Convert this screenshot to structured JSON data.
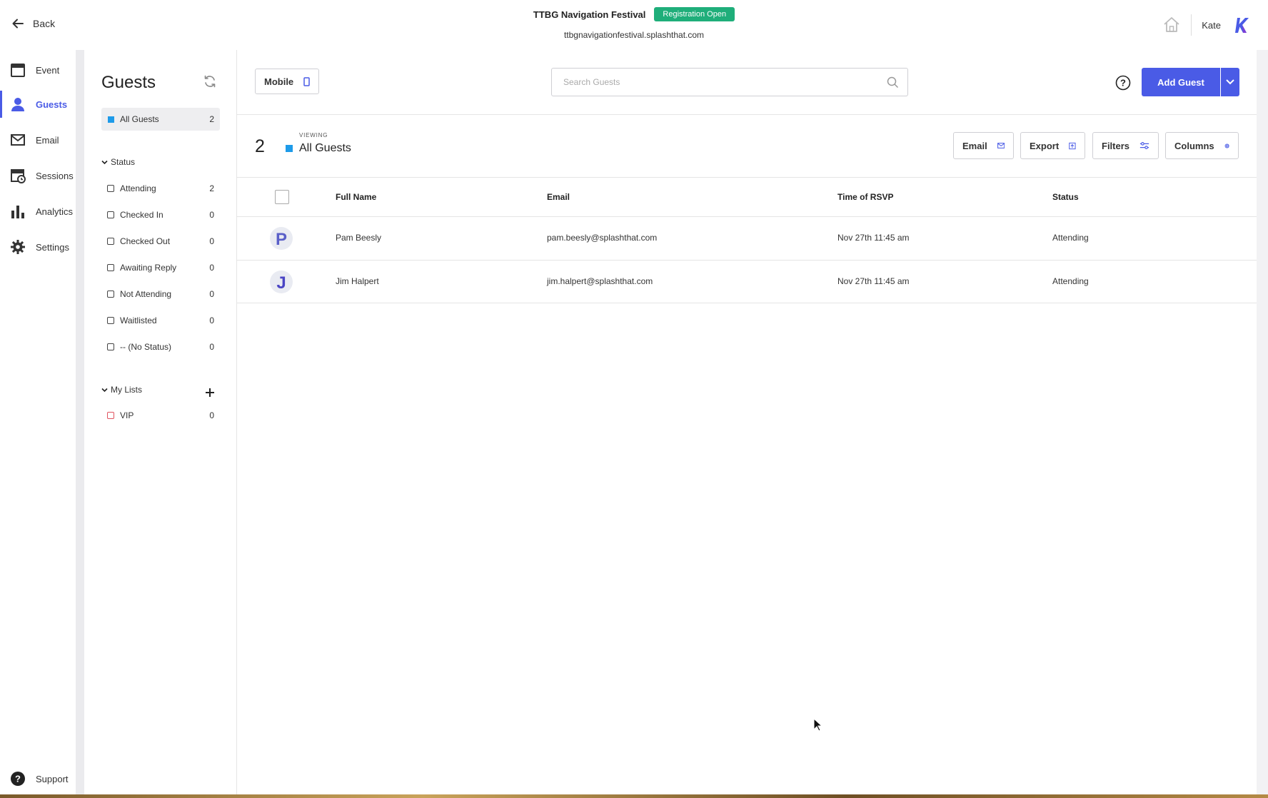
{
  "topbar": {
    "back_label": "Back",
    "event_title": "TTBG Navigation Festival",
    "status_badge": "Registration Open",
    "event_url": "ttbgnavigationfestival.splashthat.com",
    "user_name": "Kate"
  },
  "nav": {
    "items": [
      {
        "label": "Event",
        "icon": "calendar-icon"
      },
      {
        "label": "Guests",
        "icon": "person-icon",
        "active": true
      },
      {
        "label": "Email",
        "icon": "envelope-icon"
      },
      {
        "label": "Sessions",
        "icon": "sessions-icon"
      },
      {
        "label": "Analytics",
        "icon": "bar-chart-icon"
      },
      {
        "label": "Settings",
        "icon": "gear-icon"
      }
    ],
    "support_label": "Support"
  },
  "guests_panel": {
    "title": "Guests",
    "all_guests": {
      "label": "All Guests",
      "count": "2"
    },
    "status_heading": "Status",
    "statuses": [
      {
        "label": "Attending",
        "count": "2"
      },
      {
        "label": "Checked In",
        "count": "0"
      },
      {
        "label": "Checked Out",
        "count": "0"
      },
      {
        "label": "Awaiting Reply",
        "count": "0"
      },
      {
        "label": "Not Attending",
        "count": "0"
      },
      {
        "label": "Waitlisted",
        "count": "0"
      },
      {
        "label": "-- (No Status)",
        "count": "0"
      }
    ],
    "lists_heading": "My Lists",
    "lists": [
      {
        "label": "VIP",
        "count": "0"
      }
    ]
  },
  "toolbar": {
    "mobile_label": "Mobile",
    "search_placeholder": "Search Guests",
    "add_guest_label": "Add Guest"
  },
  "summary": {
    "count": "2",
    "viewing_label": "VIEWING",
    "viewing_name": "All Guests",
    "email_label": "Email",
    "export_label": "Export",
    "filters_label": "Filters",
    "columns_label": "Columns"
  },
  "table": {
    "headers": [
      "Full Name",
      "Email",
      "Time of RSVP",
      "Status"
    ],
    "rows": [
      {
        "avatar": "P",
        "name": "Pam Beesly",
        "email": "pam.beesly@splashthat.com",
        "time": "Nov 27th 11:45 am",
        "status": "Attending"
      },
      {
        "avatar": "J",
        "name": "Jim Halpert",
        "email": "jim.halpert@splashthat.com",
        "time": "Nov 27th 11:45 am",
        "status": "Attending"
      }
    ]
  },
  "colors": {
    "accent": "#4a5be6",
    "badge_green": "#1fae7a",
    "list_blue": "#1e9be9",
    "vip_red": "#e0535f"
  }
}
